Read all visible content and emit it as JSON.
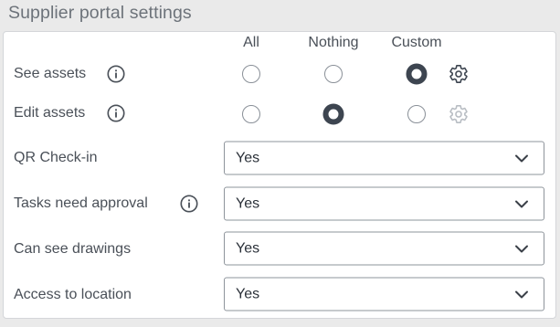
{
  "title": "Supplier portal settings",
  "columns": {
    "all": "All",
    "nothing": "Nothing",
    "custom": "Custom"
  },
  "permissions": [
    {
      "label": "See assets",
      "selected": "custom",
      "custom_gear_enabled": true
    },
    {
      "label": "Edit assets",
      "selected": "nothing",
      "custom_gear_enabled": false
    }
  ],
  "settings": [
    {
      "label": "QR Check-in",
      "value": "Yes",
      "has_info": false
    },
    {
      "label": "Tasks need approval",
      "value": "Yes",
      "has_info": true
    },
    {
      "label": "Can see drawings",
      "value": "Yes",
      "has_info": false
    },
    {
      "label": "Access to location",
      "value": "Yes",
      "has_info": false
    }
  ],
  "colors": {
    "text": "#4a5058",
    "radio_checked": "#3d4550",
    "gear_active": "#3d4550",
    "gear_disabled": "#b8bdc3"
  },
  "icons": {
    "info": "info-icon",
    "gear": "gear-icon",
    "chevron": "chevron-down-icon"
  }
}
